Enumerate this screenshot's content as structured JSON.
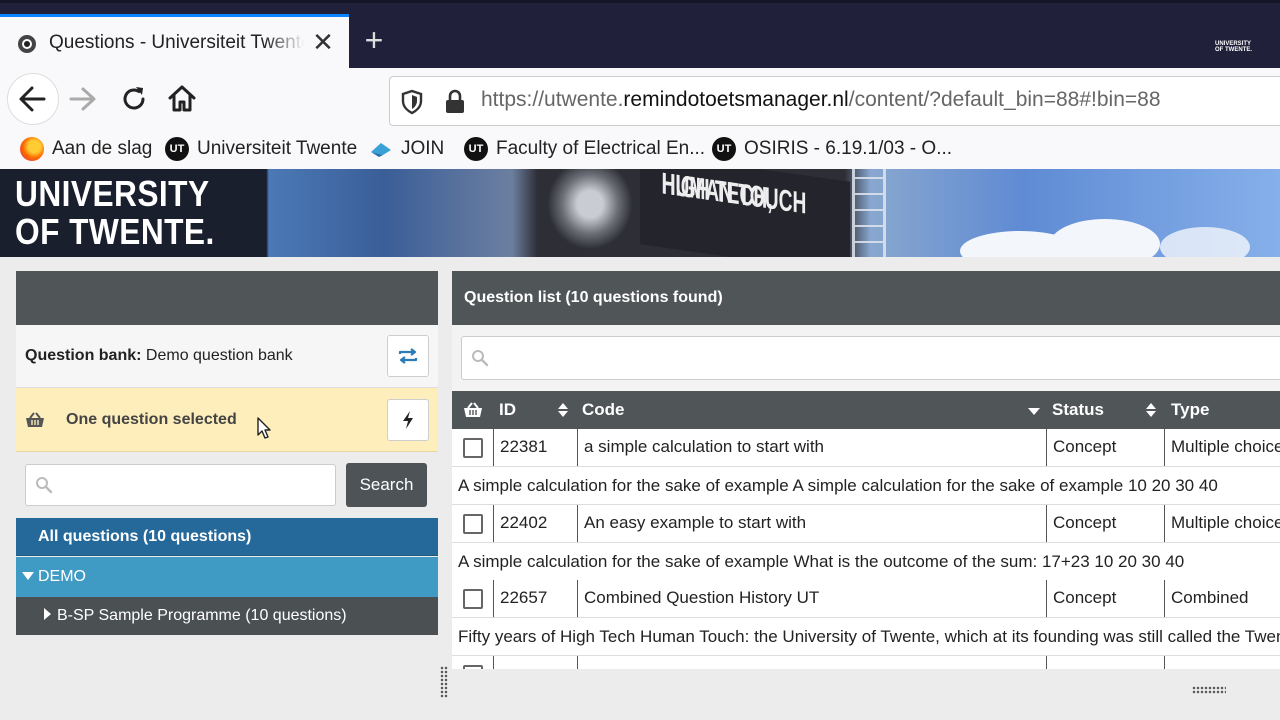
{
  "browser": {
    "tab_title": "Questions - Universiteit Twente",
    "tab_close": "✕",
    "new_tab": "+",
    "corner_logo": [
      "UNIVERSITY",
      "OF TWENTE."
    ],
    "url": {
      "prefix": "https://utwente.",
      "domain": "remindotoetsmanager.nl",
      "path": "/content/?default_bin=88#!bin=88"
    },
    "bookmarks": [
      {
        "label": "Aan de slag",
        "icon": "firefox-icon"
      },
      {
        "label": "Universiteit Twente",
        "icon": "ut-icon",
        "glyph": "UT"
      },
      {
        "label": "JOIN",
        "icon": "cloud-icon"
      },
      {
        "label": "Faculty of Electrical En...",
        "icon": "ut-icon",
        "glyph": "UT"
      },
      {
        "label": "OSIRIS - 6.19.1/03 - O...",
        "icon": "ut-icon",
        "glyph": "UT"
      }
    ]
  },
  "banner": {
    "logo_line1": "UNIVERSITY",
    "logo_line2": "OF TWENTE.",
    "billboard_line1": "HIGH TECH,",
    "billboard_line2": "HUMAN TOUCH"
  },
  "left": {
    "question_bank_label": "Question bank:",
    "question_bank_value": "Demo question bank",
    "selected_text": "One question selected",
    "search_placeholder": "",
    "search_button": "Search",
    "tree": {
      "all": "All questions (10 questions)",
      "demo": "DEMO",
      "programme": "B-SP Sample Programme (10 questions)"
    }
  },
  "right": {
    "header": "Question list  (10 questions found)",
    "filter_placeholder": "",
    "columns": {
      "id": "ID",
      "code": "Code",
      "status": "Status",
      "type": "Type"
    },
    "rows": [
      {
        "id": "22381",
        "code": "a simple calculation to start with",
        "status": "Concept",
        "type": "Multiple choice",
        "desc": "A simple calculation for the sake of example A simple calculation for the sake of example 10 20 30 40"
      },
      {
        "id": "22402",
        "code": "An easy example to start with",
        "status": "Concept",
        "type": "Multiple choice",
        "desc": "A simple calculation for the sake of example What is the outcome of the sum: 17+23 10 20 30 40"
      },
      {
        "id": "22657",
        "code": "Combined Question History UT",
        "status": "Concept",
        "type": "Combined",
        "desc": "Fifty years of High Tech Human Touch: the University of Twente, which at its founding was still called the Twente"
      }
    ]
  },
  "colors": {
    "tabbar": "#20203a",
    "panel_header": "#505558",
    "tree_all": "#25699b",
    "tree_demo": "#3f9ac4",
    "selection_bg": "#fdeebc",
    "tab_accent": "#0a84ff"
  }
}
